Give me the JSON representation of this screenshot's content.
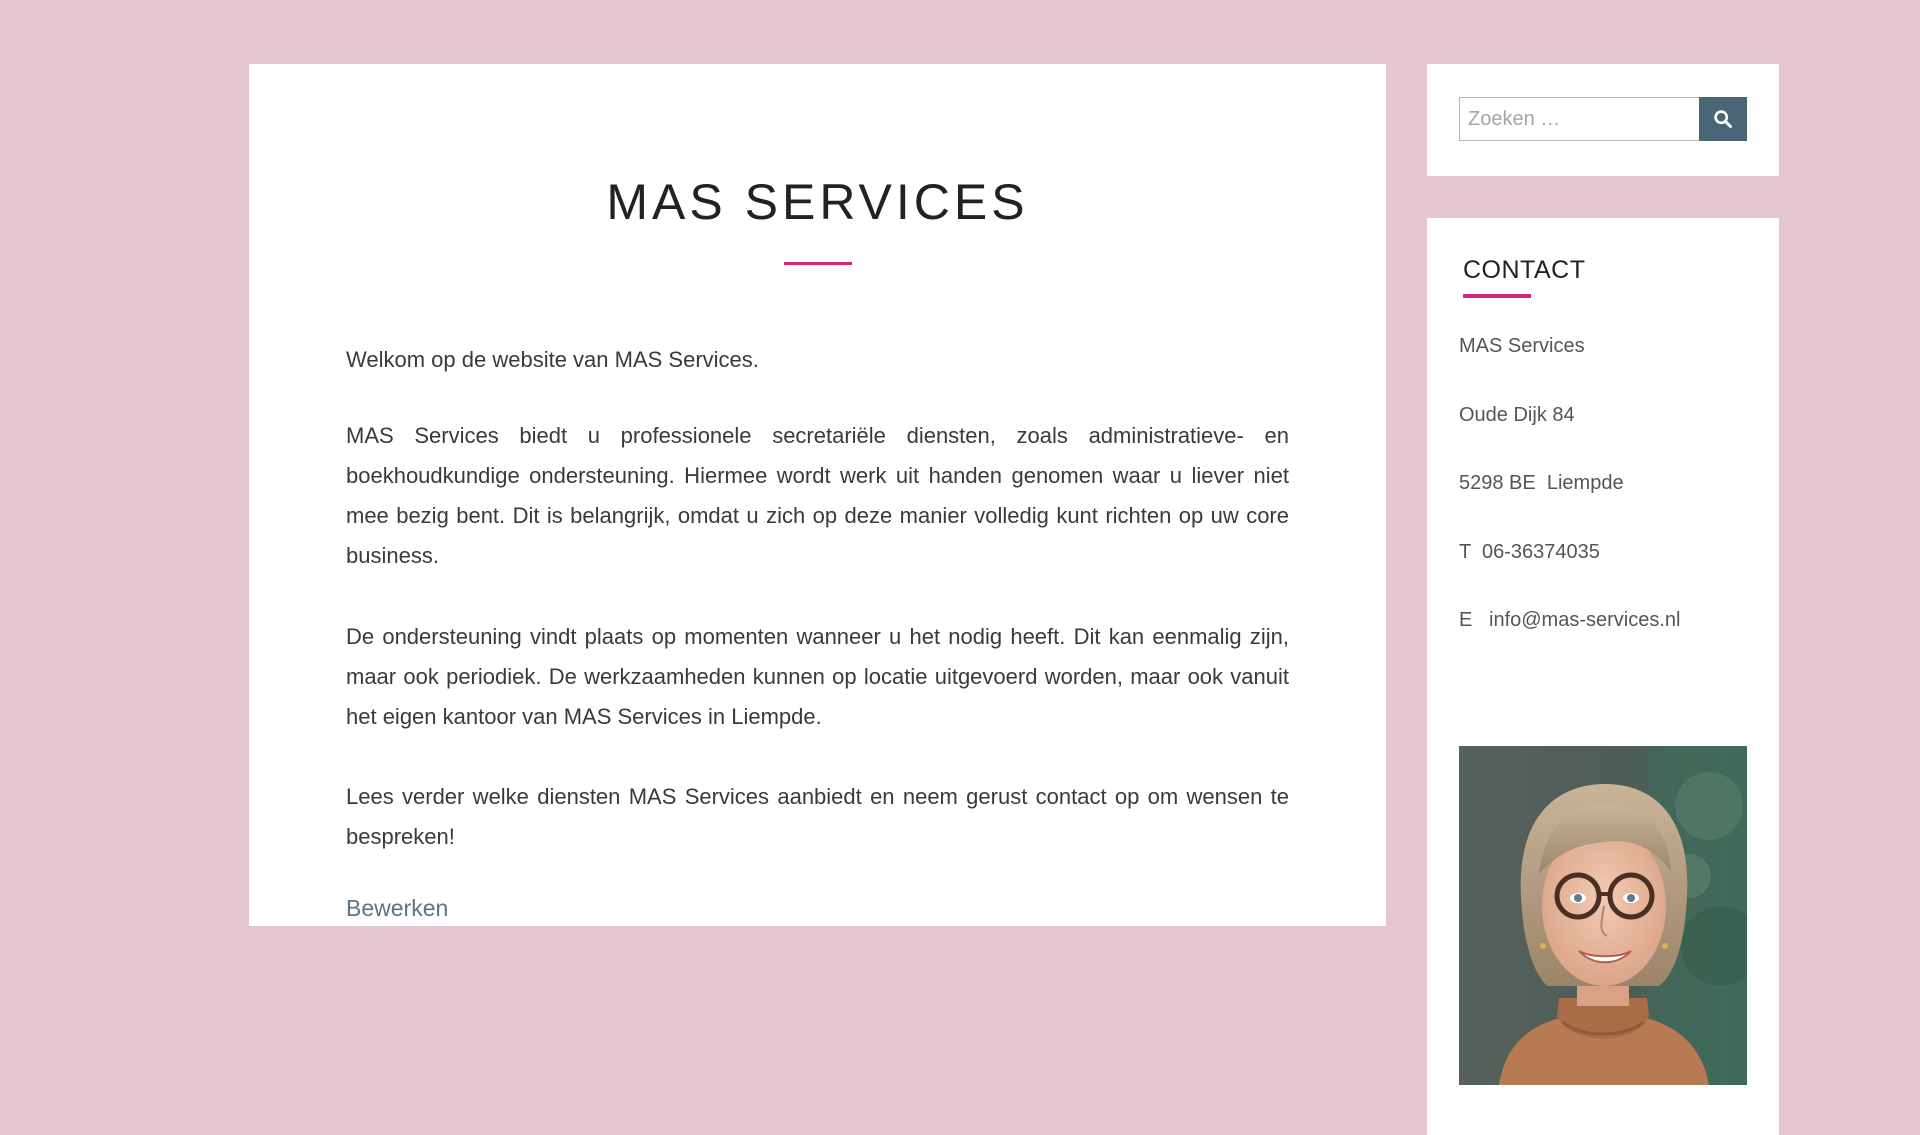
{
  "main": {
    "title": "MAS SERVICES",
    "paragraphs": [
      "Welkom op de website van MAS Services.",
      "MAS Services biedt u professionele secretariële diensten, zoals administratieve- en boekhoudkundige ondersteuning. Hiermee wordt werk uit handen genomen waar u liever niet mee bezig bent. Dit is belangrijk, omdat u zich op deze manier volledig kunt richten op uw core business.",
      "De ondersteuning vindt plaats op momenten wanneer u het nodig heeft. Dit kan eenmalig zijn, maar ook periodiek. De werkzaamheden kunnen op locatie uitgevoerd worden, maar ook vanuit het eigen kantoor van MAS Services in Liempde.",
      "Lees verder welke diensten MAS Services aanbiedt en neem gerust contact op om wensen te bespreken!"
    ],
    "edit_link": "Bewerken"
  },
  "search": {
    "placeholder": "Zoeken …",
    "value": "",
    "button_icon": "search-icon"
  },
  "contact": {
    "heading": "CONTACT",
    "company": "MAS Services",
    "street": "Oude Dijk 84",
    "postal_city": "5298 BE  Liempde",
    "phone": "T  06-36374035",
    "email": "E   info@mas-services.nl"
  },
  "colors": {
    "page_background": "#e6c5d3",
    "accent": "#d9257e",
    "link": "#5b7487",
    "search_button": "#4a6575"
  }
}
